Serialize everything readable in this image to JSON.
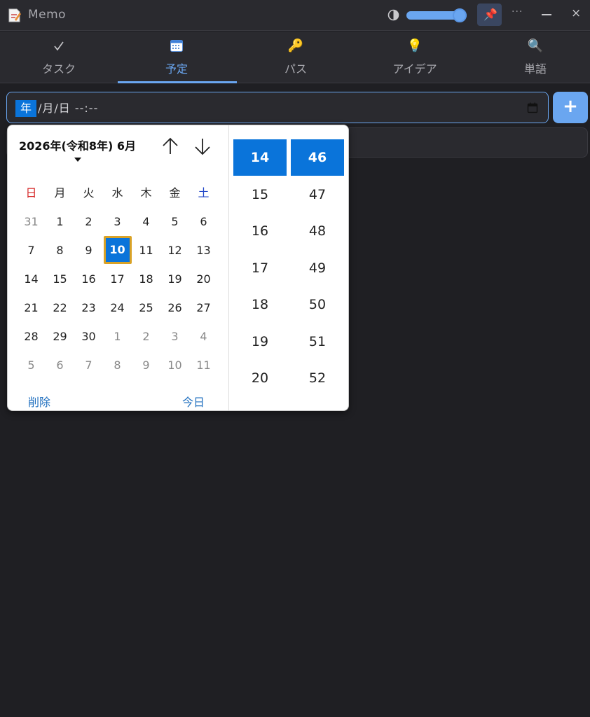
{
  "app": {
    "title": "Memo"
  },
  "titlebar": {
    "opacity_percent": 100,
    "accent_color": "#6aa6f0",
    "more_label": "···",
    "close_label": "×",
    "pin_icon": "pin-icon",
    "contrast_icon": "contrast-icon"
  },
  "tabs": [
    {
      "icon": "check-icon",
      "glyph": "✓",
      "label": "タスク",
      "active": false
    },
    {
      "icon": "calendar-icon",
      "glyph": "",
      "label": "予定",
      "active": true
    },
    {
      "icon": "key-icon",
      "glyph": "🔑",
      "label": "パス",
      "active": false
    },
    {
      "icon": "lightbulb-icon",
      "glyph": "💡",
      "label": "アイデア",
      "active": false
    },
    {
      "icon": "magnifier-icon",
      "glyph": "🔍",
      "label": "単語",
      "active": false
    }
  ],
  "datetime_input": {
    "year_segment": "年",
    "rest": "/月/日  --:--",
    "add_label": "+"
  },
  "picker": {
    "month_label": "2026年(令和8年) 6月",
    "weekdays": [
      "日",
      "月",
      "火",
      "水",
      "木",
      "金",
      "土"
    ],
    "weeks": [
      [
        {
          "d": "31",
          "m": true
        },
        {
          "d": "1"
        },
        {
          "d": "2"
        },
        {
          "d": "3"
        },
        {
          "d": "4"
        },
        {
          "d": "5"
        },
        {
          "d": "6"
        }
      ],
      [
        {
          "d": "7"
        },
        {
          "d": "8"
        },
        {
          "d": "9"
        },
        {
          "d": "10",
          "sel": true
        },
        {
          "d": "11"
        },
        {
          "d": "12"
        },
        {
          "d": "13"
        }
      ],
      [
        {
          "d": "14"
        },
        {
          "d": "15"
        },
        {
          "d": "16"
        },
        {
          "d": "17"
        },
        {
          "d": "18"
        },
        {
          "d": "19"
        },
        {
          "d": "20"
        }
      ],
      [
        {
          "d": "21"
        },
        {
          "d": "22"
        },
        {
          "d": "23"
        },
        {
          "d": "24"
        },
        {
          "d": "25"
        },
        {
          "d": "26"
        },
        {
          "d": "27"
        }
      ],
      [
        {
          "d": "28"
        },
        {
          "d": "29"
        },
        {
          "d": "30"
        },
        {
          "d": "1",
          "m": true
        },
        {
          "d": "2",
          "m": true
        },
        {
          "d": "3",
          "m": true
        },
        {
          "d": "4",
          "m": true
        }
      ],
      [
        {
          "d": "5",
          "m": true
        },
        {
          "d": "6",
          "m": true
        },
        {
          "d": "7",
          "m": true
        },
        {
          "d": "8",
          "m": true
        },
        {
          "d": "9",
          "m": true
        },
        {
          "d": "10",
          "m": true
        },
        {
          "d": "11",
          "m": true
        }
      ]
    ],
    "clear_label": "削除",
    "today_label": "今日",
    "hours": [
      "14",
      "15",
      "16",
      "17",
      "18",
      "19",
      "20"
    ],
    "minutes": [
      "46",
      "47",
      "48",
      "49",
      "50",
      "51",
      "52"
    ],
    "selected_hour": "14",
    "selected_minute": "46",
    "selection_color": "#0a74da"
  }
}
